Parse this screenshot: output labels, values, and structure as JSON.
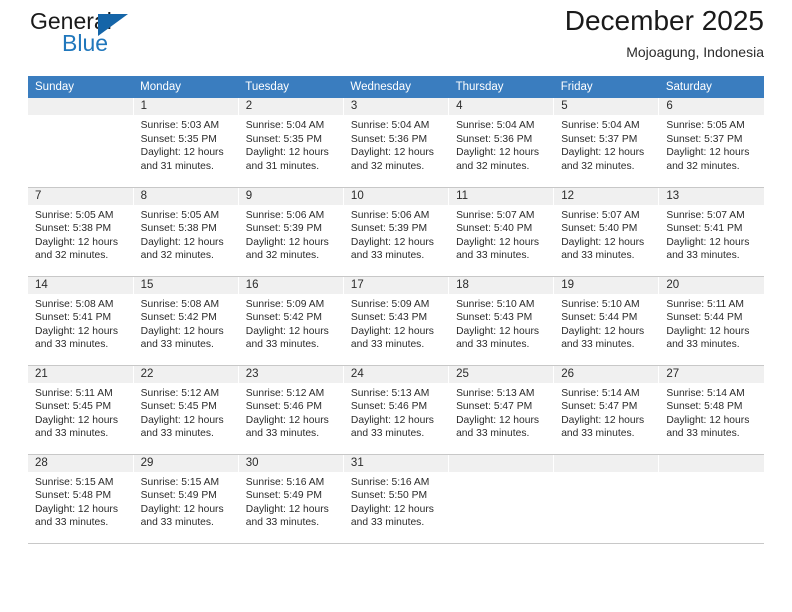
{
  "logo": {
    "word_top": "General",
    "word_bottom": "Blue",
    "triangle_color": "#1565a8",
    "blue_color": "#2077bc"
  },
  "header": {
    "title": "December 2025",
    "subtitle": "Mojoagung, Indonesia"
  },
  "theme": {
    "header_row_bg": "#3a7dbf",
    "day_band_bg": "#f0f0f0",
    "grid_line": "#c8c8c8",
    "text": "#2b2b2b"
  },
  "weekdays": [
    "Sunday",
    "Monday",
    "Tuesday",
    "Wednesday",
    "Thursday",
    "Friday",
    "Saturday"
  ],
  "weeks": [
    [
      {
        "day": "",
        "sunrise": "",
        "sunset": "",
        "daylight": ""
      },
      {
        "day": "1",
        "sunrise": "Sunrise: 5:03 AM",
        "sunset": "Sunset: 5:35 PM",
        "daylight": "Daylight: 12 hours and 31 minutes."
      },
      {
        "day": "2",
        "sunrise": "Sunrise: 5:04 AM",
        "sunset": "Sunset: 5:35 PM",
        "daylight": "Daylight: 12 hours and 31 minutes."
      },
      {
        "day": "3",
        "sunrise": "Sunrise: 5:04 AM",
        "sunset": "Sunset: 5:36 PM",
        "daylight": "Daylight: 12 hours and 32 minutes."
      },
      {
        "day": "4",
        "sunrise": "Sunrise: 5:04 AM",
        "sunset": "Sunset: 5:36 PM",
        "daylight": "Daylight: 12 hours and 32 minutes."
      },
      {
        "day": "5",
        "sunrise": "Sunrise: 5:04 AM",
        "sunset": "Sunset: 5:37 PM",
        "daylight": "Daylight: 12 hours and 32 minutes."
      },
      {
        "day": "6",
        "sunrise": "Sunrise: 5:05 AM",
        "sunset": "Sunset: 5:37 PM",
        "daylight": "Daylight: 12 hours and 32 minutes."
      }
    ],
    [
      {
        "day": "7",
        "sunrise": "Sunrise: 5:05 AM",
        "sunset": "Sunset: 5:38 PM",
        "daylight": "Daylight: 12 hours and 32 minutes."
      },
      {
        "day": "8",
        "sunrise": "Sunrise: 5:05 AM",
        "sunset": "Sunset: 5:38 PM",
        "daylight": "Daylight: 12 hours and 32 minutes."
      },
      {
        "day": "9",
        "sunrise": "Sunrise: 5:06 AM",
        "sunset": "Sunset: 5:39 PM",
        "daylight": "Daylight: 12 hours and 32 minutes."
      },
      {
        "day": "10",
        "sunrise": "Sunrise: 5:06 AM",
        "sunset": "Sunset: 5:39 PM",
        "daylight": "Daylight: 12 hours and 33 minutes."
      },
      {
        "day": "11",
        "sunrise": "Sunrise: 5:07 AM",
        "sunset": "Sunset: 5:40 PM",
        "daylight": "Daylight: 12 hours and 33 minutes."
      },
      {
        "day": "12",
        "sunrise": "Sunrise: 5:07 AM",
        "sunset": "Sunset: 5:40 PM",
        "daylight": "Daylight: 12 hours and 33 minutes."
      },
      {
        "day": "13",
        "sunrise": "Sunrise: 5:07 AM",
        "sunset": "Sunset: 5:41 PM",
        "daylight": "Daylight: 12 hours and 33 minutes."
      }
    ],
    [
      {
        "day": "14",
        "sunrise": "Sunrise: 5:08 AM",
        "sunset": "Sunset: 5:41 PM",
        "daylight": "Daylight: 12 hours and 33 minutes."
      },
      {
        "day": "15",
        "sunrise": "Sunrise: 5:08 AM",
        "sunset": "Sunset: 5:42 PM",
        "daylight": "Daylight: 12 hours and 33 minutes."
      },
      {
        "day": "16",
        "sunrise": "Sunrise: 5:09 AM",
        "sunset": "Sunset: 5:42 PM",
        "daylight": "Daylight: 12 hours and 33 minutes."
      },
      {
        "day": "17",
        "sunrise": "Sunrise: 5:09 AM",
        "sunset": "Sunset: 5:43 PM",
        "daylight": "Daylight: 12 hours and 33 minutes."
      },
      {
        "day": "18",
        "sunrise": "Sunrise: 5:10 AM",
        "sunset": "Sunset: 5:43 PM",
        "daylight": "Daylight: 12 hours and 33 minutes."
      },
      {
        "day": "19",
        "sunrise": "Sunrise: 5:10 AM",
        "sunset": "Sunset: 5:44 PM",
        "daylight": "Daylight: 12 hours and 33 minutes."
      },
      {
        "day": "20",
        "sunrise": "Sunrise: 5:11 AM",
        "sunset": "Sunset: 5:44 PM",
        "daylight": "Daylight: 12 hours and 33 minutes."
      }
    ],
    [
      {
        "day": "21",
        "sunrise": "Sunrise: 5:11 AM",
        "sunset": "Sunset: 5:45 PM",
        "daylight": "Daylight: 12 hours and 33 minutes."
      },
      {
        "day": "22",
        "sunrise": "Sunrise: 5:12 AM",
        "sunset": "Sunset: 5:45 PM",
        "daylight": "Daylight: 12 hours and 33 minutes."
      },
      {
        "day": "23",
        "sunrise": "Sunrise: 5:12 AM",
        "sunset": "Sunset: 5:46 PM",
        "daylight": "Daylight: 12 hours and 33 minutes."
      },
      {
        "day": "24",
        "sunrise": "Sunrise: 5:13 AM",
        "sunset": "Sunset: 5:46 PM",
        "daylight": "Daylight: 12 hours and 33 minutes."
      },
      {
        "day": "25",
        "sunrise": "Sunrise: 5:13 AM",
        "sunset": "Sunset: 5:47 PM",
        "daylight": "Daylight: 12 hours and 33 minutes."
      },
      {
        "day": "26",
        "sunrise": "Sunrise: 5:14 AM",
        "sunset": "Sunset: 5:47 PM",
        "daylight": "Daylight: 12 hours and 33 minutes."
      },
      {
        "day": "27",
        "sunrise": "Sunrise: 5:14 AM",
        "sunset": "Sunset: 5:48 PM",
        "daylight": "Daylight: 12 hours and 33 minutes."
      }
    ],
    [
      {
        "day": "28",
        "sunrise": "Sunrise: 5:15 AM",
        "sunset": "Sunset: 5:48 PM",
        "daylight": "Daylight: 12 hours and 33 minutes."
      },
      {
        "day": "29",
        "sunrise": "Sunrise: 5:15 AM",
        "sunset": "Sunset: 5:49 PM",
        "daylight": "Daylight: 12 hours and 33 minutes."
      },
      {
        "day": "30",
        "sunrise": "Sunrise: 5:16 AM",
        "sunset": "Sunset: 5:49 PM",
        "daylight": "Daylight: 12 hours and 33 minutes."
      },
      {
        "day": "31",
        "sunrise": "Sunrise: 5:16 AM",
        "sunset": "Sunset: 5:50 PM",
        "daylight": "Daylight: 12 hours and 33 minutes."
      },
      {
        "day": "",
        "sunrise": "",
        "sunset": "",
        "daylight": ""
      },
      {
        "day": "",
        "sunrise": "",
        "sunset": "",
        "daylight": ""
      },
      {
        "day": "",
        "sunrise": "",
        "sunset": "",
        "daylight": ""
      }
    ]
  ]
}
